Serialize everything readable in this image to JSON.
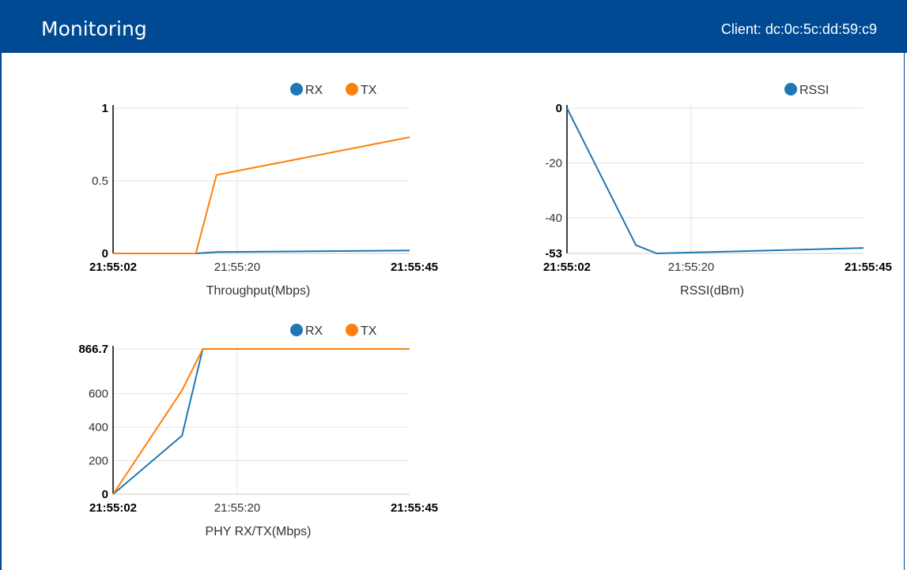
{
  "header": {
    "title": "Monitoring",
    "client_label": "Client: dc:0c:5c:dd:59:c9"
  },
  "colors": {
    "rx": "#1f77b4",
    "tx": "#ff7f0e",
    "rssi": "#1f77b4",
    "header_bg": "#004a93"
  },
  "charts": {
    "throughput": {
      "caption": "Throughput(Mbps)",
      "legend": [
        "RX",
        "TX"
      ]
    },
    "rssi": {
      "caption": "RSSI(dBm)",
      "legend": [
        "RSSI"
      ]
    },
    "phy": {
      "caption": "PHY RX/TX(Mbps)",
      "legend": [
        "RX",
        "TX"
      ]
    }
  },
  "chart_data": [
    {
      "type": "line",
      "id": "throughput",
      "xlabel": "Throughput(Mbps)",
      "xlim": [
        "21:55:02",
        "21:55:45"
      ],
      "x_ticks": [
        "21:55:02",
        "21:55:20",
        "21:55:45"
      ],
      "y_ticks": [
        "0",
        "0.5",
        "1"
      ],
      "ylim": [
        0,
        1
      ],
      "grid": true,
      "legend_position": "top-right",
      "series": [
        {
          "name": "RX",
          "color": "#1f77b4",
          "points": [
            [
              "21:55:02",
              0
            ],
            [
              "21:55:14",
              0
            ],
            [
              "21:55:17",
              0.01
            ],
            [
              "21:55:45",
              0.02
            ]
          ]
        },
        {
          "name": "TX",
          "color": "#ff7f0e",
          "points": [
            [
              "21:55:02",
              0
            ],
            [
              "21:55:14",
              0
            ],
            [
              "21:55:17",
              0.54
            ],
            [
              "21:55:45",
              0.8
            ]
          ]
        }
      ]
    },
    {
      "type": "line",
      "id": "rssi",
      "xlabel": "RSSI(dBm)",
      "xlim": [
        "21:55:02",
        "21:55:45"
      ],
      "x_ticks": [
        "21:55:02",
        "21:55:20",
        "21:55:45"
      ],
      "y_ticks": [
        "-53",
        "-40",
        "-20",
        "0"
      ],
      "ylim": [
        -53,
        0
      ],
      "grid": true,
      "legend_position": "top-right",
      "series": [
        {
          "name": "RSSI",
          "color": "#1f77b4",
          "points": [
            [
              "21:55:02",
              0
            ],
            [
              "21:55:12",
              -50
            ],
            [
              "21:55:15",
              -53
            ],
            [
              "21:55:45",
              -51
            ]
          ]
        }
      ]
    },
    {
      "type": "line",
      "id": "phy",
      "xlabel": "PHY RX/TX(Mbps)",
      "xlim": [
        "21:55:02",
        "21:55:45"
      ],
      "x_ticks": [
        "21:55:02",
        "21:55:20",
        "21:55:45"
      ],
      "y_ticks": [
        "0",
        "200",
        "400",
        "600",
        "866.7"
      ],
      "ylim": [
        0,
        866.7
      ],
      "grid": true,
      "legend_position": "top-right",
      "series": [
        {
          "name": "RX",
          "color": "#1f77b4",
          "points": [
            [
              "21:55:02",
              0
            ],
            [
              "21:55:12",
              350
            ],
            [
              "21:55:15",
              866.7
            ],
            [
              "21:55:45",
              866.7
            ]
          ]
        },
        {
          "name": "TX",
          "color": "#ff7f0e",
          "points": [
            [
              "21:55:02",
              0
            ],
            [
              "21:55:12",
              620
            ],
            [
              "21:55:15",
              866.7
            ],
            [
              "21:55:45",
              866.7
            ]
          ]
        }
      ]
    }
  ]
}
